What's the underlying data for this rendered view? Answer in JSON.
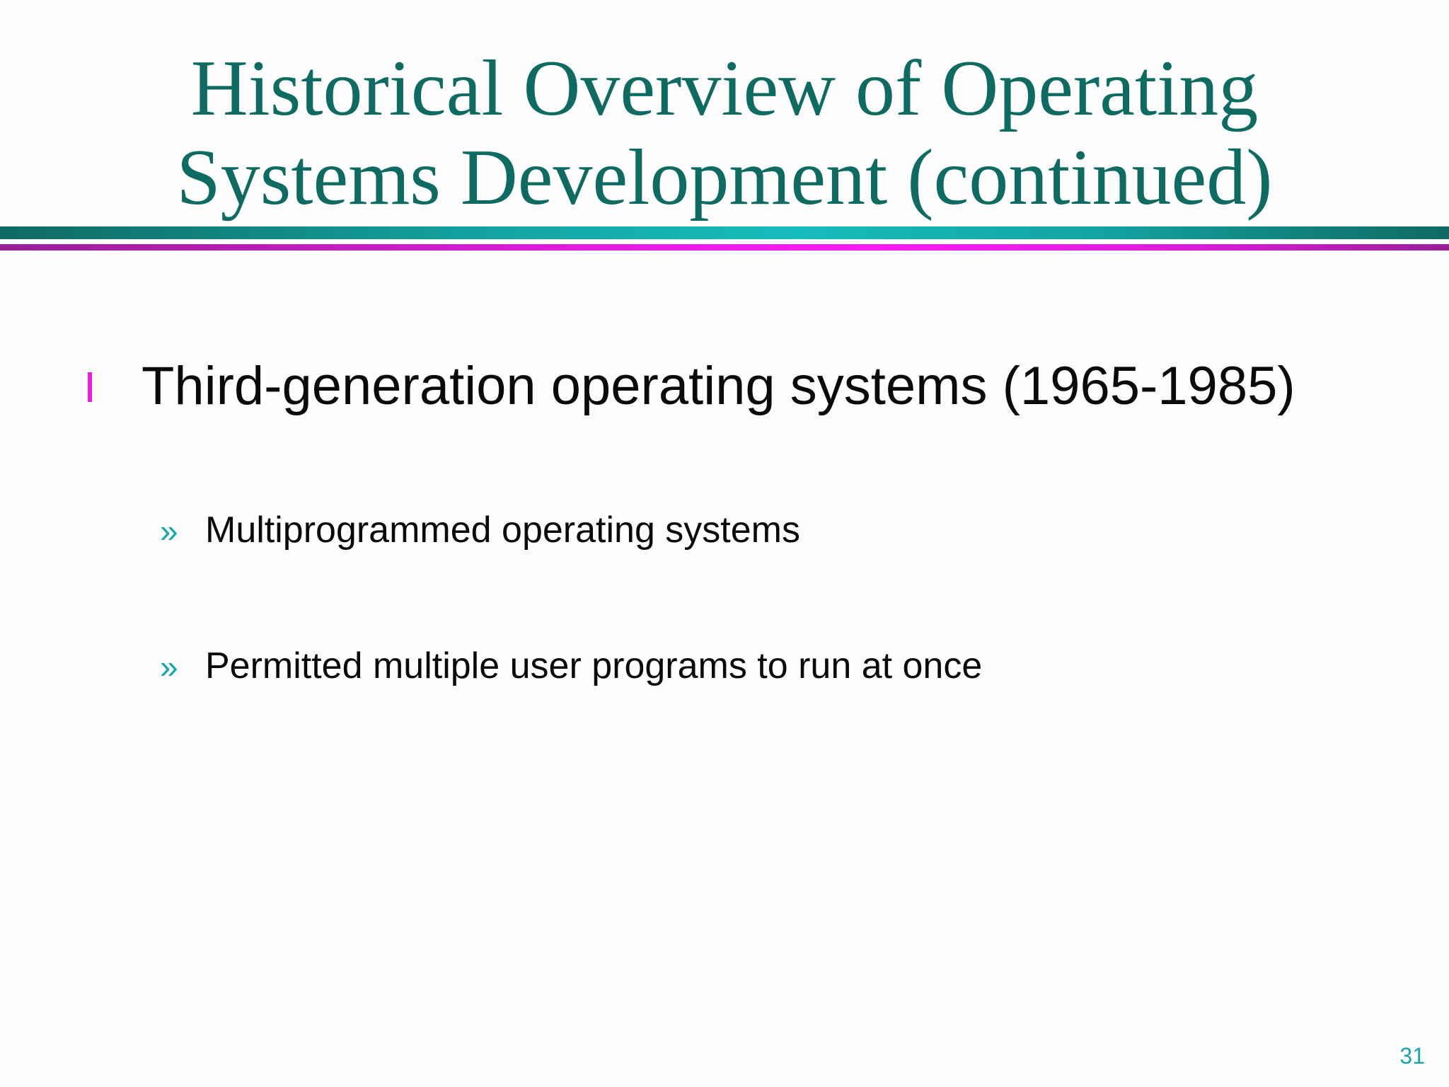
{
  "slide": {
    "title_lines": [
      "Historical Overview of Operating",
      "Systems Development (continued)"
    ],
    "main_bullet": {
      "text": "Third-generation operating systems (1965-1985)"
    },
    "sub_bullets": [
      {
        "marker": "»",
        "text": "Multiprogrammed operating systems"
      },
      {
        "marker": "»",
        "text": "Permitted multiple user programs to run at once"
      }
    ],
    "page_number": "31"
  },
  "colors": {
    "title": "#0e6b62",
    "rule_teal": "#17bcbc",
    "rule_magenta": "#ff1bff",
    "main_bullet_marker": "#e61ce6",
    "sub_bullet_marker": "#17a6a9",
    "page_number": "#17a6a9"
  },
  "icons": {
    "main_bullet": "vertical-bar-bullet-icon",
    "sub_bullet": "double-chevron-bullet-icon"
  }
}
